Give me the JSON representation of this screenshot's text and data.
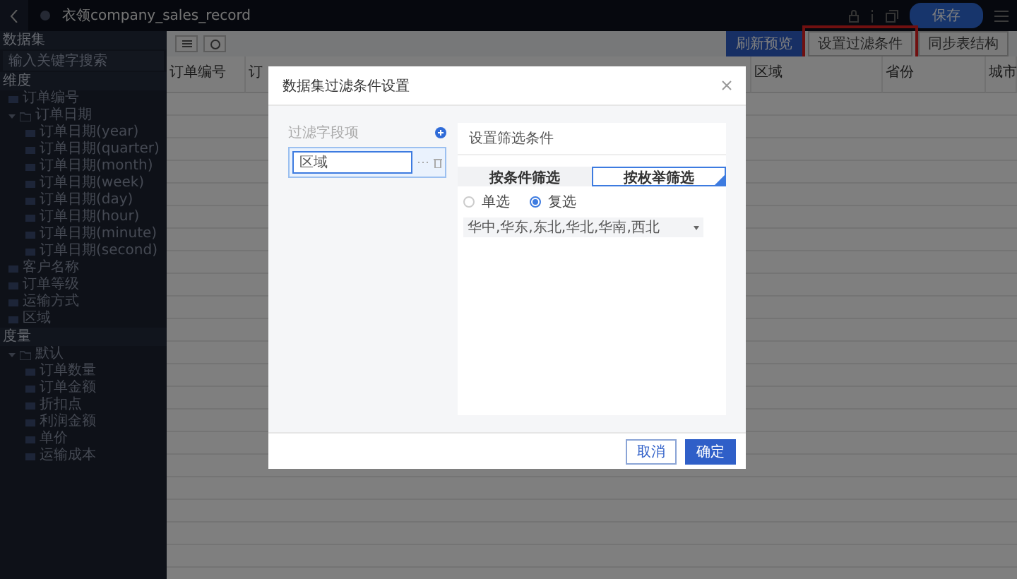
{
  "topbar": {
    "title": "衣领company_sales_record",
    "save_button": "保存"
  },
  "sidebar": {
    "title": "数据集",
    "search": {
      "placeholder": "输入关键字搜索"
    },
    "sections": [
      {
        "title": "维度",
        "items": [
          {
            "label": "订单编号"
          },
          {
            "label": "订单日期",
            "expanded": true,
            "children": [
              {
                "label": "订单日期(year)"
              },
              {
                "label": "订单日期(quarter)"
              },
              {
                "label": "订单日期(month)"
              },
              {
                "label": "订单日期(week)"
              },
              {
                "label": "订单日期(day)"
              },
              {
                "label": "订单日期(hour)"
              },
              {
                "label": "订单日期(minute)"
              },
              {
                "label": "订单日期(second)"
              }
            ]
          },
          {
            "label": "客户名称"
          },
          {
            "label": "订单等级"
          },
          {
            "label": "运输方式"
          },
          {
            "label": "区域"
          }
        ]
      },
      {
        "title": "度量",
        "items": [
          {
            "label": "默认",
            "expanded": true,
            "children": [
              {
                "label": "订单数量"
              },
              {
                "label": "订单金额"
              },
              {
                "label": "折扣点"
              },
              {
                "label": "利润金额"
              },
              {
                "label": "单价"
              },
              {
                "label": "运输成本"
              }
            ]
          }
        ]
      }
    ]
  },
  "toolbar": {
    "buttons": [
      {
        "label": "刷新预览",
        "kind": "primary",
        "highlighted": false
      },
      {
        "label": "设置过滤条件",
        "kind": "default",
        "highlighted": true
      },
      {
        "label": "同步表结构",
        "kind": "default",
        "highlighted": false
      }
    ]
  },
  "table": {
    "columns": [
      "订单编号",
      "订",
      "区域",
      "省份",
      "城市"
    ]
  },
  "dialog": {
    "title": "数据集过滤条件设置",
    "fields_label": "过滤字段项",
    "fields": [
      {
        "label": "区域",
        "selected": true
      }
    ],
    "conditions_title": "设置筛选条件",
    "tabs": [
      {
        "label": "按条件筛选",
        "selected": false
      },
      {
        "label": "按枚举筛选",
        "selected": true
      }
    ],
    "radios": [
      {
        "label": "单选",
        "selected": false
      },
      {
        "label": "复选",
        "selected": true
      }
    ],
    "select_value": "华中,华东,东北,华北,华南,西北",
    "buttons": [
      {
        "label": "取消",
        "kind": "default"
      },
      {
        "label": "确定",
        "kind": "primary"
      }
    ]
  }
}
